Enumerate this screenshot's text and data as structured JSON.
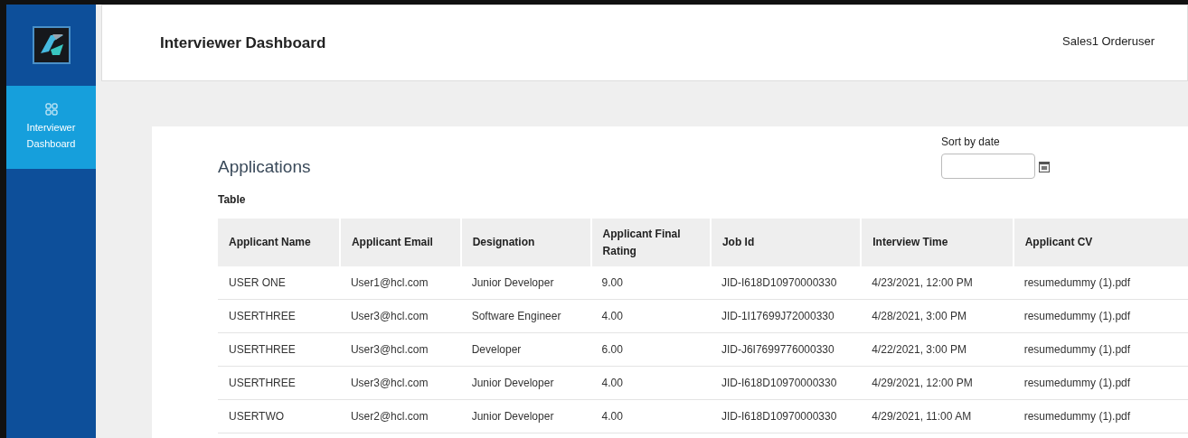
{
  "sidebar": {
    "items": [
      {
        "label": "Interviewer Dashboard",
        "selected": true
      }
    ]
  },
  "header": {
    "title": "Interviewer Dashboard",
    "user": "Sales1 Orderuser"
  },
  "applications": {
    "title": "Applications",
    "sort": {
      "label": "Sort by date"
    },
    "table_caption": "Table",
    "table": {
      "columns": [
        "Applicant Name",
        "Applicant Email",
        "Designation",
        "Applicant Final Rating",
        "Job Id",
        "Interview Time",
        "Applicant CV"
      ],
      "rows": [
        [
          "USER ONE",
          "User1@hcl.com",
          "Junior Developer",
          "9.00",
          "JID-I618D10970000330",
          "4/23/2021, 12:00 PM",
          "resumedummy (1).pdf"
        ],
        [
          "USERTHREE",
          "User3@hcl.com",
          "Software Engineer",
          "4.00",
          "JID-1I17699J72000330",
          "4/28/2021, 3:00 PM",
          "resumedummy (1).pdf"
        ],
        [
          "USERTHREE",
          "User3@hcl.com",
          "Developer",
          "6.00",
          "JID-J6I7699776000330",
          "4/22/2021, 3:00 PM",
          "resumedummy (1).pdf"
        ],
        [
          "USERTHREE",
          "User3@hcl.com",
          "Junior Developer",
          "4.00",
          "JID-I618D10970000330",
          "4/29/2021, 12:00 PM",
          "resumedummy (1).pdf"
        ],
        [
          "USERTWO",
          "User2@hcl.com",
          "Junior Developer",
          "4.00",
          "JID-I618D10970000330",
          "4/29/2021, 11:00 AM",
          "resumedummy (1).pdf"
        ]
      ]
    }
  }
}
